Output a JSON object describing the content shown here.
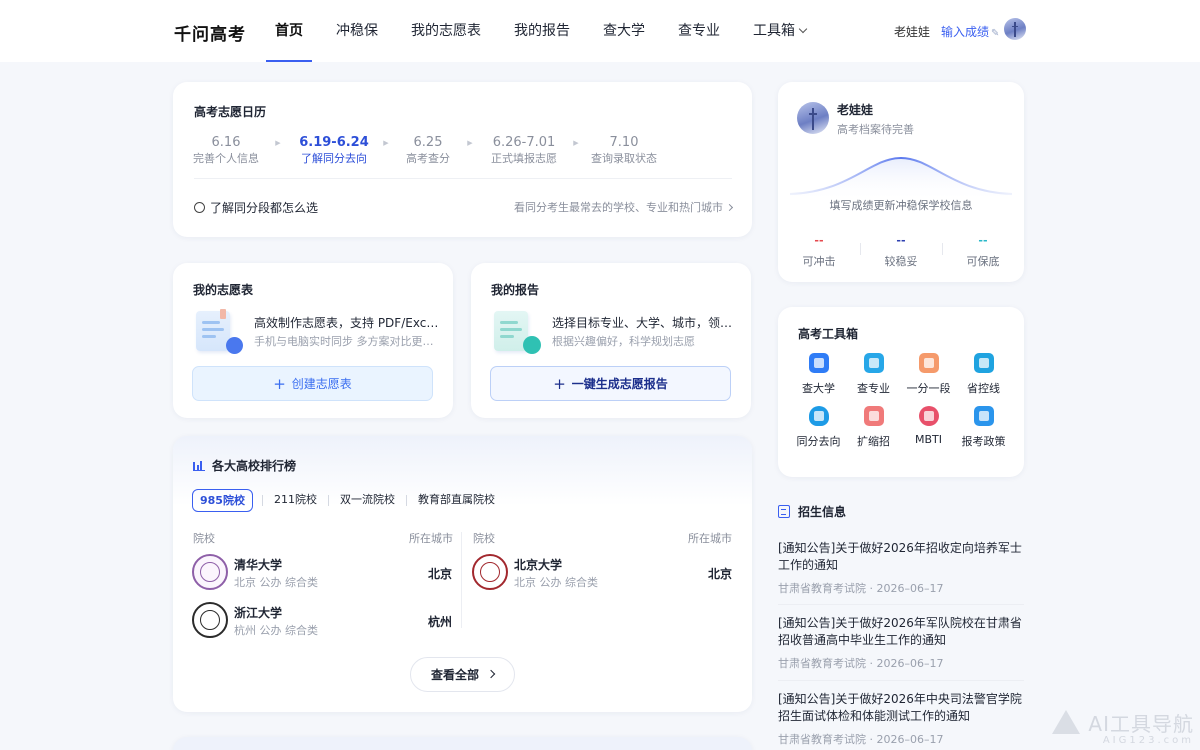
{
  "header": {
    "brand": "千问高考",
    "nav": [
      "首页",
      "冲稳保",
      "我的志愿表",
      "我的报告",
      "查大学",
      "查专业",
      "工具箱"
    ],
    "user_name": "老娃娃",
    "score_link": "输入成绩"
  },
  "calendar": {
    "title": "高考志愿日历",
    "steps": [
      {
        "date": "6.16",
        "label": "完善个人信息"
      },
      {
        "date": "6.19-6.24",
        "label": "了解同分去向"
      },
      {
        "date": "6.25",
        "label": "高考查分"
      },
      {
        "date": "6.26-7.01",
        "label": "正式填报志愿"
      },
      {
        "date": "7.10",
        "label": "查询录取状态"
      }
    ],
    "active_step": 1,
    "radio_label": "了解同分段都怎么选",
    "link": "看同分考生最常去的学校、专业和热门城市"
  },
  "volunteer": {
    "title": "我的志愿表",
    "main": "高效制作志愿表，支持 PDF/Excel导出",
    "sub": "手机与电脑实时同步 多方案对比更清晰",
    "button": "创建志愿表"
  },
  "report": {
    "title": "我的报告",
    "main": "选择目标专业、大学、城市，领取专属报告",
    "sub": "根据兴趣偏好，科学规划志愿",
    "button": "一键生成志愿报告"
  },
  "ranking": {
    "title": "各大高校排行榜",
    "tabs": [
      "985院校",
      "211院校",
      "双一流院校",
      "教育部直属院校"
    ],
    "col_school": "院校",
    "col_city": "所在城市",
    "schools": [
      {
        "name": "清华大学",
        "meta": "北京 公办 综合类",
        "city": "北京"
      },
      {
        "name": "浙江大学",
        "meta": "杭州 公办 综合类",
        "city": "杭州"
      },
      {
        "name": "北京大学",
        "meta": "北京 公办 综合类",
        "city": "北京"
      }
    ],
    "view_all": "查看全部"
  },
  "profile": {
    "name": "老娃娃",
    "status": "高考档案待完善",
    "hint": "填写成绩更新冲稳保学校信息",
    "stats": [
      {
        "value": "--",
        "label": "可冲击",
        "color": "#e5484d"
      },
      {
        "value": "--",
        "label": "较稳妥",
        "color": "#2d3fb0"
      },
      {
        "value": "--",
        "label": "可保底",
        "color": "#2ab8c9"
      }
    ]
  },
  "tools": {
    "title": "高考工具箱",
    "items": [
      {
        "label": "查大学",
        "icon": "university-icon",
        "color": "#2f7cf6"
      },
      {
        "label": "查专业",
        "icon": "major-icon",
        "color": "#27a7e8"
      },
      {
        "label": "一分一段",
        "icon": "score-segment-icon",
        "color": "#f59a6b"
      },
      {
        "label": "省控线",
        "icon": "control-line-icon",
        "color": "#1fa3e0"
      },
      {
        "label": "同分去向",
        "icon": "same-score-icon",
        "color": "#1d9be6"
      },
      {
        "label": "扩缩招",
        "icon": "enrollment-change-icon",
        "color": "#f07a7a"
      },
      {
        "label": "MBTI",
        "icon": "mbti-icon",
        "color": "#e8506a"
      },
      {
        "label": "报考政策",
        "icon": "policy-icon",
        "color": "#2b95ec"
      }
    ]
  },
  "news": {
    "title": "招生信息",
    "items": [
      {
        "text": "[通知公告]关于做好2026年招收定向培养军士工作的通知",
        "source": "甘肃省教育考试院",
        "date": "2026–06–17"
      },
      {
        "text": "[通知公告]关于做好2026年军队院校在甘肃省招收普通高中毕业生工作的通知",
        "source": "甘肃省教育考试院",
        "date": "2026–06–17"
      },
      {
        "text": "[通知公告]关于做好2026年中央司法警官学院招生面试体检和体能测试工作的通知",
        "source": "甘肃省教育考试院",
        "date": "2026–06–17"
      }
    ]
  },
  "watermark": {
    "main": "AI工具导航",
    "sub": "AIG123.com"
  }
}
